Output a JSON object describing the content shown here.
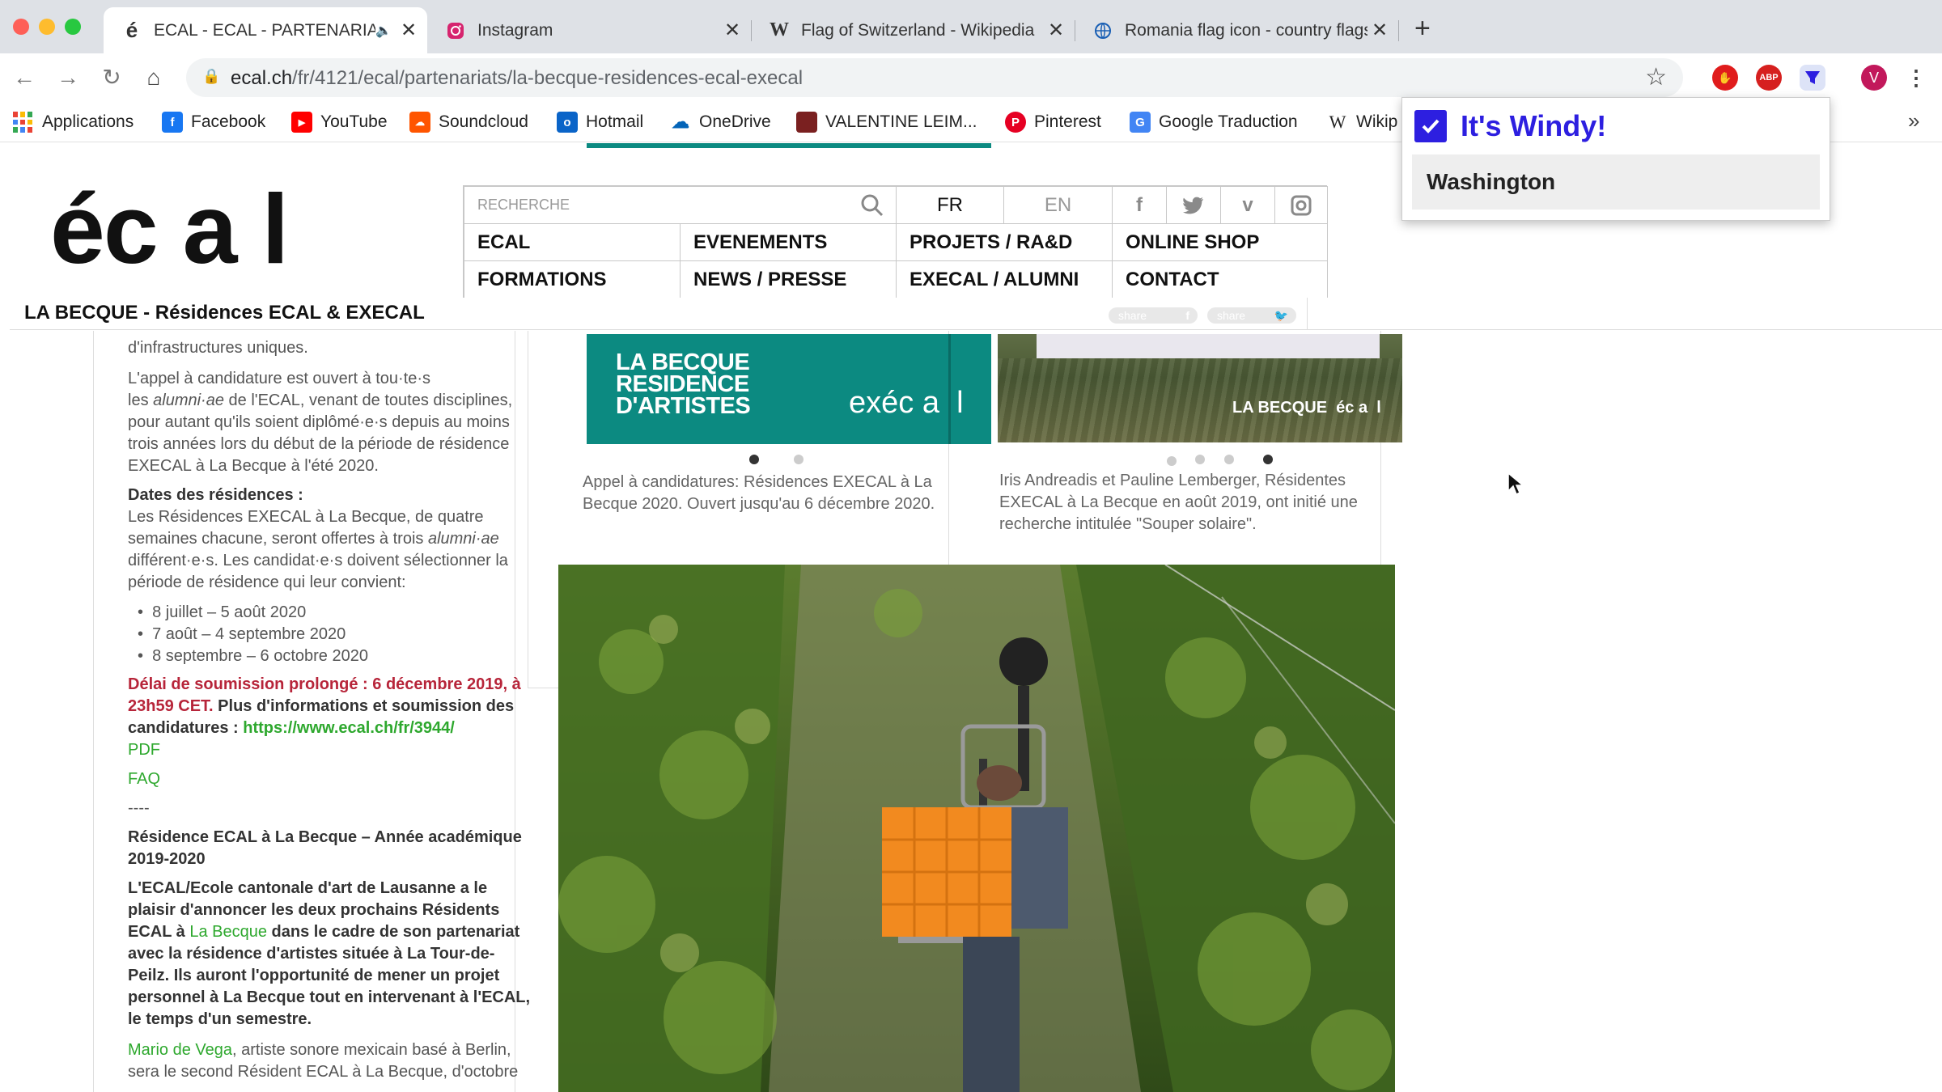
{
  "tabs": [
    {
      "title": "ECAL - ECAL - PARTENARIATS - LA BECQUE",
      "favicon": "é",
      "active": true,
      "muted_icon": "speaker-icon"
    },
    {
      "title": "Instagram",
      "favicon": "instagram-icon",
      "active": false
    },
    {
      "title": "Flag of Switzerland - Wikipedia",
      "favicon": "W",
      "active": false
    },
    {
      "title": "Romania flag icon - country flags",
      "favicon": "globe-icon",
      "active": false
    }
  ],
  "new_tab": "+",
  "close": "✕",
  "toolbar": {
    "url_host": "ecal.ch",
    "url_path": "/fr/4121/ecal/partenariats/la-becque-residences-ecal-execal",
    "profile_initial": "V",
    "abp_label": "ABP"
  },
  "bookmarks": [
    {
      "label": "Applications"
    },
    {
      "label": "Facebook"
    },
    {
      "label": "YouTube"
    },
    {
      "label": "Soundcloud"
    },
    {
      "label": "Hotmail"
    },
    {
      "label": "OneDrive"
    },
    {
      "label": "VALENTINE LEIM..."
    },
    {
      "label": "Pinterest"
    },
    {
      "label": "Google Traduction"
    },
    {
      "label": "Wikip"
    }
  ],
  "bookmarks_overflow": "»",
  "site": {
    "logo": "éc a  l",
    "search_placeholder": "RECHERCHE",
    "lang_fr": "FR",
    "lang_en": "EN",
    "nav": [
      [
        "ECAL",
        "EVENEMENTS",
        "PROJETS / RA&D",
        "ONLINE SHOP"
      ],
      [
        "FORMATIONS",
        "NEWS / PRESSE",
        "EXECAL / ALUMNI",
        "CONTACT"
      ]
    ],
    "social_icons": [
      "f",
      "t",
      "v",
      "ig"
    ],
    "page_title": "LA BECQUE - Résidences ECAL & EXECAL",
    "share1": "share",
    "share2": "share"
  },
  "carousel1": {
    "banner_line1": "LA BECQUE",
    "banner_line2": "RESIDENCE",
    "banner_line3": "D'ARTISTES",
    "banner_logo": "exéc a  l",
    "caption": "Appel à candidatures: Résidences EXECAL à La Becque 2020. Ouvert jusqu'au 6 décembre 2020.",
    "active_dot": 0,
    "dots": 2
  },
  "carousel2": {
    "overlay_label": "LA BECQUE  éc a  l",
    "caption": "Iris Andreadis et Pauline Lemberger, Résidentes EXECAL à La Becque en août 2019, ont initié une recherche intitulée \"Souper solaire\".",
    "active_dot": 3,
    "dots": 4
  },
  "article": {
    "p0": "d'infrastructures uniques.",
    "p1_a": "L'appel à candidature est ouvert à tou·te·s",
    "p1_b": "les",
    "p1_c": "alumni·ae",
    "p1_d": "de l'ECAL, venant de toutes disciplines,",
    "p1_e": "pour autant qu'ils soient diplômé·e·s depuis au moins",
    "p1_f": "trois années lors du début de la période de résidence",
    "p1_g": "EXECAL à La Becque à l'été 2020.",
    "dates_heading": "Dates des résidences :",
    "p2_a": "Les Résidences EXECAL à La Becque, de quatre",
    "p2_b": "semaines chacune, seront offertes à trois",
    "p2_c": "alumni·ae",
    "p2_d": "différent·e·s. Les candidat·e·s doivent sélectionner la",
    "p2_e": "période de résidence qui leur convient:",
    "dates": [
      "8 juillet – 5 août 2020",
      "7 août – 4 septembre 2020",
      "8 septembre – 6 octobre 2020"
    ],
    "deadline_a": "Délai de soumission prolongé : 6 décembre 2019, à",
    "deadline_b": "23h59 CET.",
    "deadline_c": "Plus d'informations et soumission des",
    "deadline_d": "candidatures :",
    "deadline_link": "https://www.ecal.ch/fr/3944/",
    "pdf": "PDF",
    "faq": "FAQ",
    "sep": "----",
    "res_heading_a": "Résidence ECAL à La Becque – Année académique",
    "res_heading_b": "2019-2020",
    "p3_a": "L'ECAL/Ecole cantonale d'art de Lausanne a le",
    "p3_b": "plaisir d'annoncer les deux prochains Résidents",
    "p3_c": "ECAL à",
    "p3_link": "La Becque",
    "p3_d": "dans le cadre de son partenariat",
    "p3_e": "avec la résidence d'artistes située à La Tour-de-",
    "p3_f": "Peilz. Ils auront l'opportunité de mener un projet",
    "p3_g": "personnel à La Becque tout en intervenant à l'ECAL,",
    "p3_h": "le temps d'un semestre.",
    "p4_link": "Mario de Vega",
    "p4_a": ", artiste sonore mexicain basé à Berlin,",
    "p4_b": "sera le second Résident ECAL à La Becque, d'octobre"
  },
  "windy": {
    "title": "It's Windy!",
    "city": "Washington",
    "accent": "#2d1fe0"
  }
}
